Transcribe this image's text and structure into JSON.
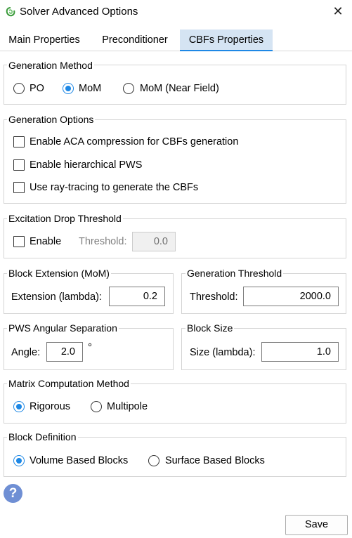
{
  "window": {
    "title": "Solver Advanced Options",
    "close_symbol": "✕"
  },
  "tabs": [
    {
      "label": "Main Properties",
      "active": false
    },
    {
      "label": "Preconditioner",
      "active": false
    },
    {
      "label": "CBFs Properties",
      "active": true
    }
  ],
  "generation_method": {
    "title": "Generation Method",
    "options": [
      {
        "label": "PO",
        "selected": false
      },
      {
        "label": "MoM",
        "selected": true
      },
      {
        "label": "MoM (Near Field)",
        "selected": false
      }
    ]
  },
  "generation_options": {
    "title": "Generation Options",
    "items": [
      {
        "label": "Enable ACA compression for CBFs generation",
        "checked": false
      },
      {
        "label": "Enable hierarchical PWS",
        "checked": false
      },
      {
        "label": "Use ray-tracing to generate the CBFs",
        "checked": false
      }
    ]
  },
  "excitation_drop": {
    "title": "Excitation Drop Threshold",
    "enable_label": "Enable",
    "enabled": false,
    "threshold_label": "Threshold:",
    "threshold_value": "0.0"
  },
  "block_extension": {
    "title": "Block Extension (MoM)",
    "label": "Extension (lambda):",
    "value": "0.2"
  },
  "generation_threshold": {
    "title": "Generation Threshold",
    "label": "Threshold:",
    "value": "2000.0"
  },
  "pws_angular": {
    "title": "PWS Angular Separation",
    "label": "Angle:",
    "value": "2.0",
    "unit": "°"
  },
  "block_size": {
    "title": "Block Size",
    "label": "Size (lambda):",
    "value": "1.0"
  },
  "matrix_method": {
    "title": "Matrix Computation Method",
    "options": [
      {
        "label": "Rigorous",
        "selected": true
      },
      {
        "label": "Multipole",
        "selected": false
      }
    ]
  },
  "block_definition": {
    "title": "Block Definition",
    "options": [
      {
        "label": "Volume Based Blocks",
        "selected": true
      },
      {
        "label": "Surface Based Blocks",
        "selected": false
      }
    ]
  },
  "footer": {
    "help_symbol": "?",
    "save_label": "Save"
  },
  "colors": {
    "accent": "#1e88e5",
    "tab_active_bg": "#d5e4f3",
    "help_bg": "#6f8fd4"
  }
}
